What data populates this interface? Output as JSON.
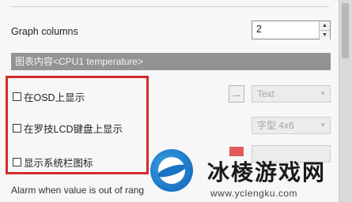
{
  "graph_columns": {
    "label": "Graph columns",
    "value": "2",
    "up": "▲",
    "down": "▼"
  },
  "section_header": "图表内容<CPU1 temperature>",
  "options": [
    {
      "label": "在OSD上显示"
    },
    {
      "label": "在罗技LCD键盘上显示"
    },
    {
      "label": "显示系统栏图标"
    }
  ],
  "dots_button": "...",
  "dropdowns": {
    "osd_type": "Text",
    "lcd_font": "字型 4x6",
    "arrow": "▼"
  },
  "alarm_label": "Alarm when value is out of rang",
  "colors": {
    "highlight": "#d32b2b",
    "header_bg": "#939393",
    "swatch": "#e05a5a"
  },
  "watermark": {
    "title": "冰棱游戏网",
    "url": "www.yclengku.com"
  }
}
